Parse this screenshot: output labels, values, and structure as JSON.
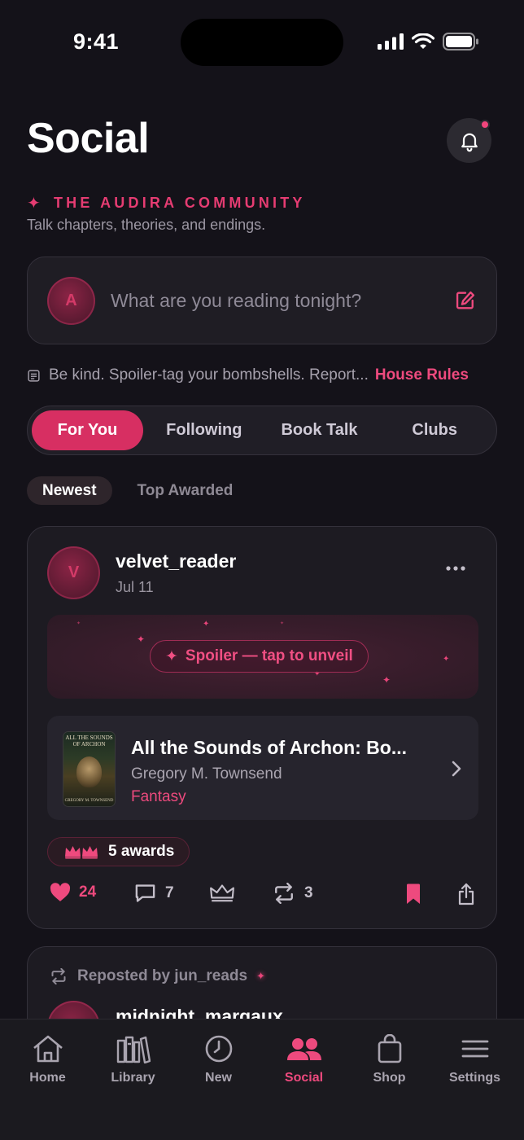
{
  "status_bar": {
    "time": "9:41"
  },
  "header": {
    "title": "Social",
    "eyebrow": "THE AUDIRA COMMUNITY",
    "subtitle": "Talk chapters, theories, and endings."
  },
  "composer": {
    "avatar_initial": "A",
    "placeholder": "What are you reading tonight?"
  },
  "rules": {
    "text": "Be kind. Spoiler-tag your bombshells. Report...",
    "link_label": "House Rules"
  },
  "tabs": [
    {
      "label": "For You",
      "active": true
    },
    {
      "label": "Following",
      "active": false
    },
    {
      "label": "Book Talk",
      "active": false
    },
    {
      "label": "Clubs",
      "active": false
    }
  ],
  "sort": [
    {
      "label": "Newest",
      "active": true
    },
    {
      "label": "Top Awarded",
      "active": false
    }
  ],
  "post": {
    "avatar_initial": "V",
    "author": "velvet_reader",
    "date": "Jul 11",
    "spoiler_label": "Spoiler — tap to unveil",
    "book": {
      "title": "All the Sounds of Archon: Bo...",
      "author": "Gregory M. Townsend",
      "genre": "Fantasy",
      "cover_title": "ALL THE SOUNDS OF ARCHON",
      "cover_author": "GREGORY M. TOWNSEND"
    },
    "awards_label": "5 awards",
    "likes": "24",
    "comments": "7",
    "reposts": "3"
  },
  "post2": {
    "repost_label": "Reposted by jun_reads",
    "author": "midnight_margaux"
  },
  "nav": [
    {
      "label": "Home",
      "icon": "home-icon"
    },
    {
      "label": "Library",
      "icon": "library-icon"
    },
    {
      "label": "New",
      "icon": "clock-icon"
    },
    {
      "label": "Social",
      "icon": "people-icon",
      "active": true
    },
    {
      "label": "Shop",
      "icon": "bag-icon"
    },
    {
      "label": "Settings",
      "icon": "menu-icon"
    }
  ],
  "colors": {
    "background": "#141219",
    "accent": "#e63c72",
    "active_tab": "#d72f62",
    "card": "#1d1b22"
  }
}
